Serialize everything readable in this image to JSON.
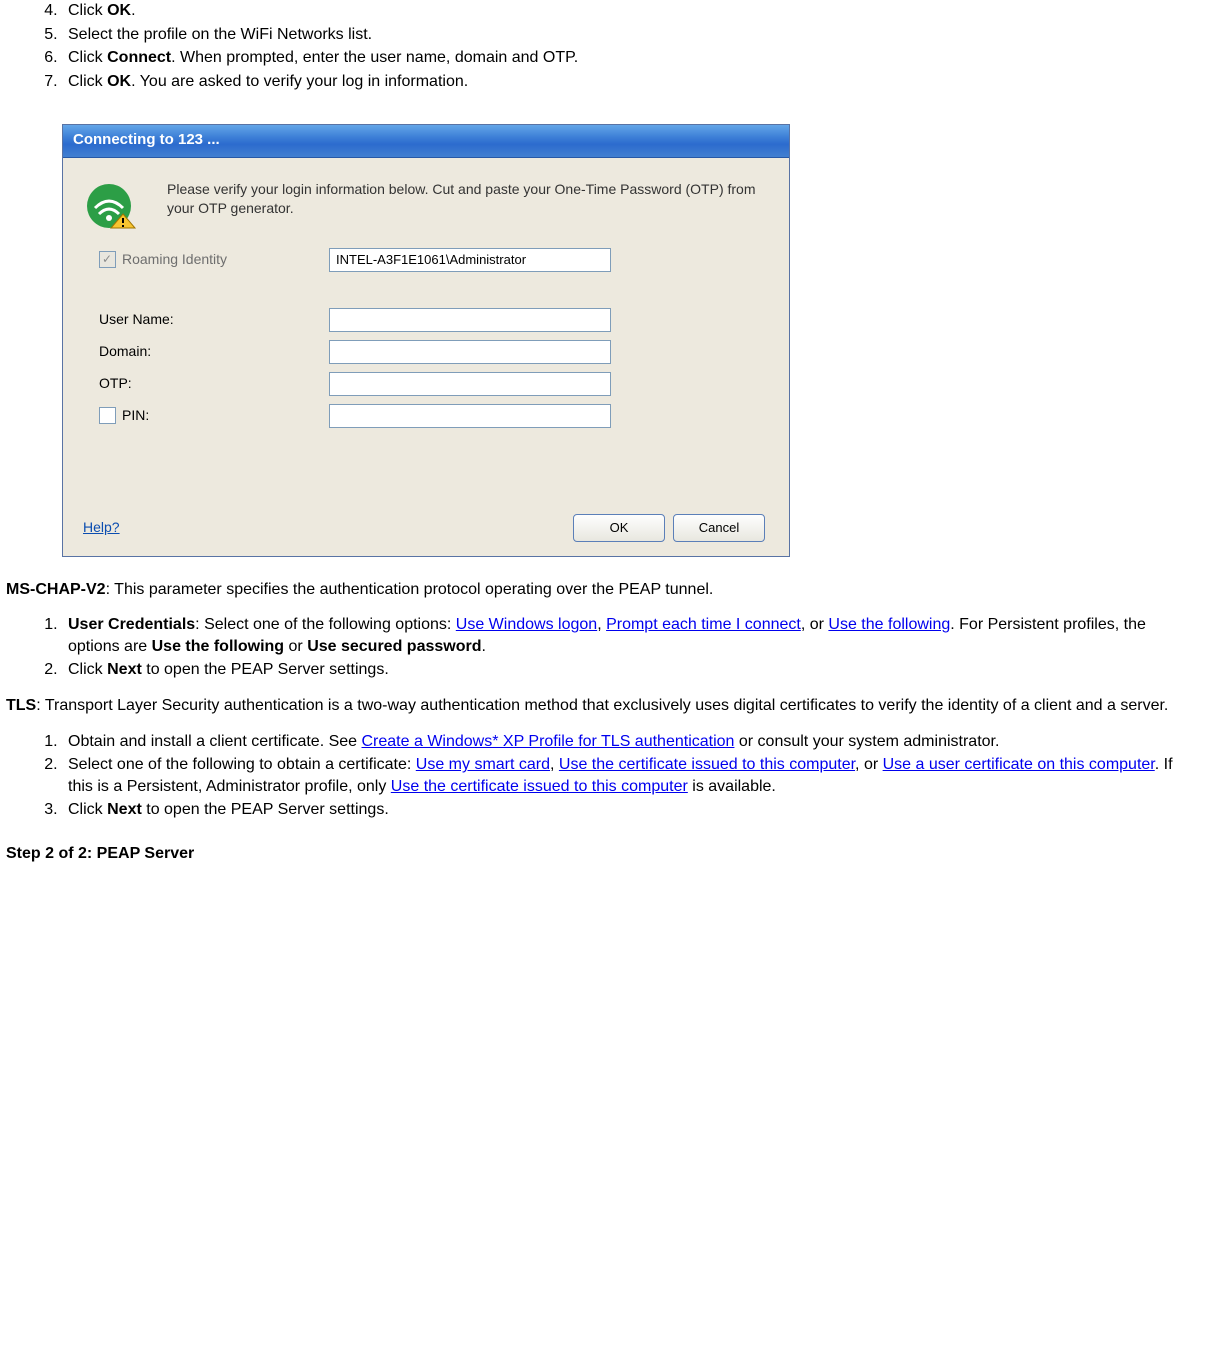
{
  "steps_top": [
    {
      "pre": "Click ",
      "bold": "OK",
      "post": "."
    },
    {
      "pre": "Select the profile on the WiFi Networks list.",
      "bold": "",
      "post": ""
    },
    {
      "pre": "Click ",
      "bold": "Connect",
      "post": ". When prompted, enter the user name, domain and OTP."
    },
    {
      "pre": "Click ",
      "bold": "OK",
      "post": ". You are asked to verify your log in information."
    }
  ],
  "dialog": {
    "title": "Connecting to 123 ...",
    "info_text": "Please verify your login information below. Cut and paste your One-Time Password (OTP) from your OTP generator.",
    "roaming_label": "Roaming Identity",
    "roaming_value": "INTEL-A3F1E1061\\Administrator",
    "username_label": "User Name:",
    "domain_label": "Domain:",
    "otp_label": "OTP:",
    "pin_label": "PIN:",
    "help_label": "Help?",
    "ok_label": "OK",
    "cancel_label": "Cancel"
  },
  "mschap": {
    "heading_bold": "MS-CHAP-V2",
    "heading_rest": ": This parameter specifies the authentication protocol operating over the PEAP tunnel.",
    "item1": {
      "bold": "User Credentials",
      "t1": ": Select one of the following options: ",
      "link1": "Use Windows logon",
      "t2": ", ",
      "link2": "Prompt each time I connect",
      "t3": ", or ",
      "link3": "Use the following",
      "t4": ". For Persistent profiles, the options are ",
      "bold2": "Use the following",
      "t5": " or ",
      "bold3": "Use secured password",
      "t6": "."
    },
    "item2": {
      "t1": "Click ",
      "bold": "Next",
      "t2": " to open the PEAP Server settings."
    }
  },
  "tls": {
    "heading_bold": "TLS",
    "heading_rest": ": Transport Layer Security authentication is a two-way authentication method that exclusively uses digital certificates to verify the identity of a client and a server.",
    "item1": {
      "t1": "Obtain and install a client certificate. See ",
      "link1": "Create a Windows* XP Profile for TLS authentication",
      "t2": " or consult your system administrator."
    },
    "item2": {
      "t1": "Select one of the following to obtain a certificate: ",
      "link1": "Use my smart card",
      "t2": ", ",
      "link2": "Use the certificate issued to this computer",
      "t3": ", or ",
      "link3": "Use a user certificate on this computer",
      "t4": ". If this is a Persistent, Administrator profile, only ",
      "link4": "Use the certificate issued to this computer",
      "t5": " is available."
    },
    "item3": {
      "t1": "Click ",
      "bold": "Next",
      "t2": " to open the PEAP Server settings."
    }
  },
  "step2_title": "Step 2 of 2: PEAP Server"
}
